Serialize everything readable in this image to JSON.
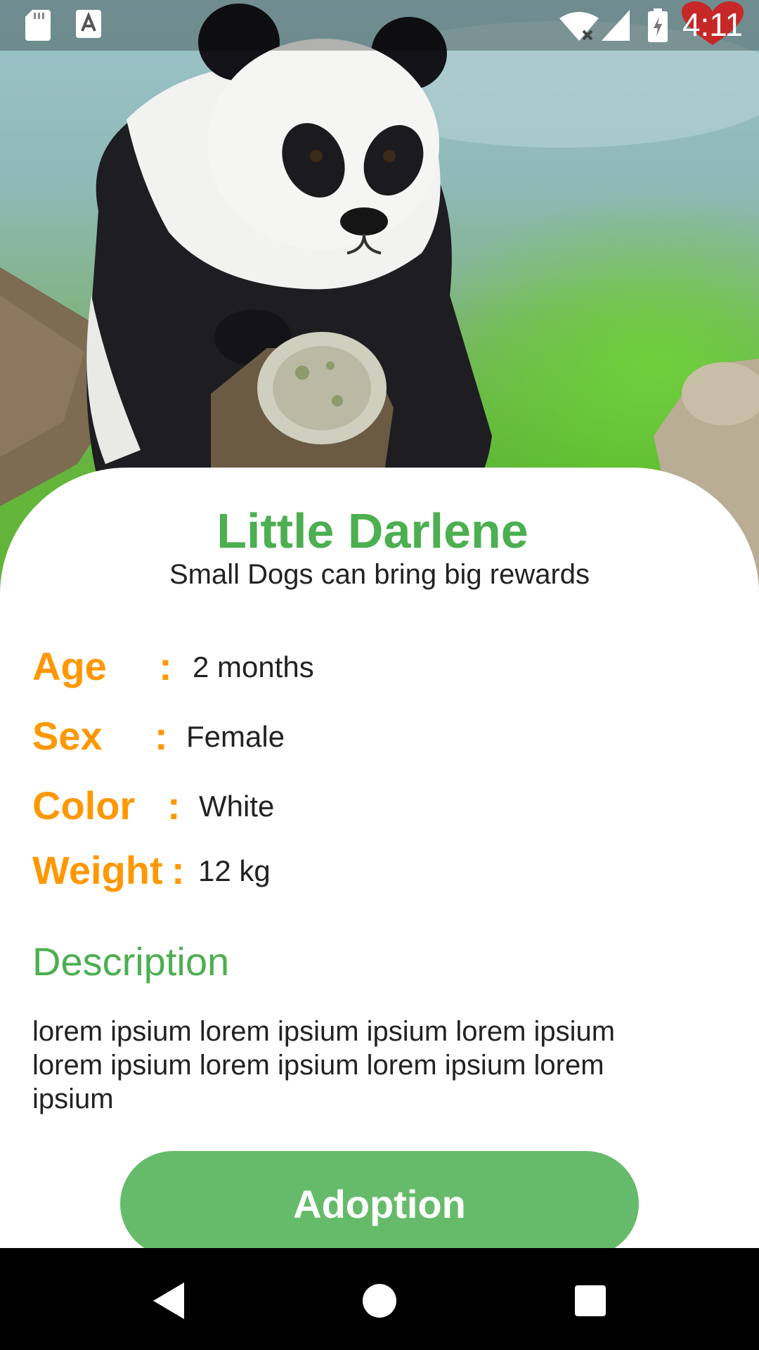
{
  "status_bar": {
    "time": "4:11",
    "left_icons": [
      "sd-card-icon",
      "text-a-icon"
    ],
    "right_icons": [
      "wifi-off-icon",
      "signal-icon",
      "battery-charging-icon",
      "heart-icon"
    ]
  },
  "hero": {
    "image": "panda-photo"
  },
  "pet": {
    "name": "Little Darlene",
    "tagline": "Small Dogs can bring big rewards"
  },
  "attributes": [
    {
      "label": "Age",
      "colon": ":",
      "value": "2 months"
    },
    {
      "label": "Sex",
      "colon": ":",
      "value": "Female"
    },
    {
      "label": "Color",
      "colon": ":",
      "value": "White"
    },
    {
      "label": "Weight",
      "colon": ":",
      "value": "12 kg"
    }
  ],
  "description": {
    "title": "Description",
    "text": "lorem ipsium lorem ipsium ipsium lorem ipsium lorem ipsium lorem ipsium lorem ipsium lorem ipsium"
  },
  "actions": {
    "adopt_label": "Adoption"
  },
  "colors": {
    "primary_green": "#4caf50",
    "button_green": "#66bb6a",
    "label_orange": "#ff9800",
    "heart_red": "#c62828"
  },
  "nav_bar": {
    "icons": [
      "back-icon",
      "home-icon",
      "recents-icon"
    ]
  }
}
